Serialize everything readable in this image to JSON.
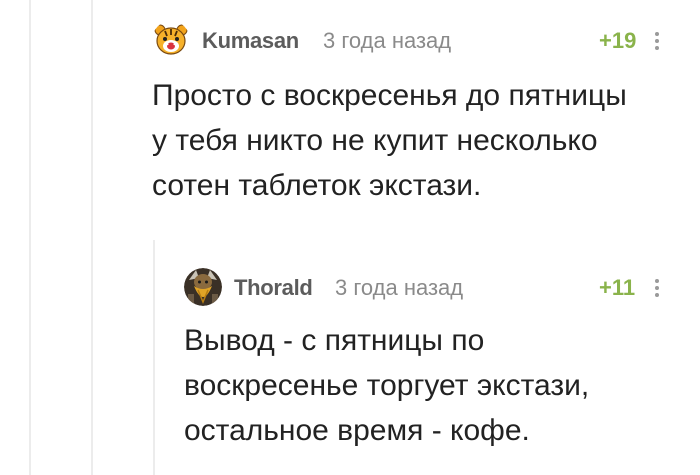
{
  "comments": [
    {
      "username": "Kumasan",
      "timestamp": "3 года назад",
      "rating": "+19",
      "avatar_icon": "tiger-avatar-icon",
      "body_lines": [
        "Просто с воскресенья до пятницы",
        "у тебя никто не купит несколько",
        "сотен таблеток экстази."
      ]
    },
    {
      "username": "Thorald",
      "timestamp": "3 года назад",
      "rating": "+11",
      "avatar_icon": "dwarf-avatar-icon",
      "body_lines": [
        "Вывод - с пятницы по",
        "воскресенье торгует экстази,",
        "остальное время - кофе."
      ]
    }
  ],
  "colors": {
    "username": "#5c5c5c",
    "timestamp": "#8a8a8a",
    "rating_positive": "#8ab34b",
    "body_text": "#222222",
    "thread_line": "#ececec"
  }
}
